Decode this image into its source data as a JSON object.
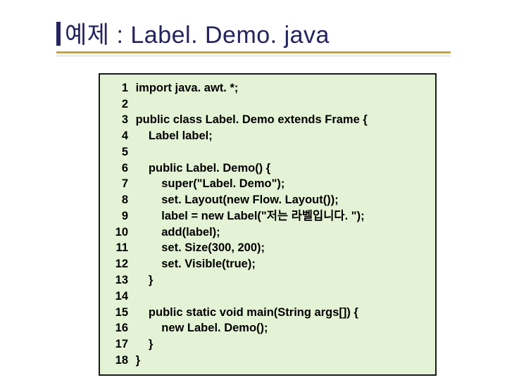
{
  "slide": {
    "title": "예제 : Label. Demo. java"
  },
  "code": {
    "lines": [
      {
        "n": "1",
        "t": " import java. awt. *;"
      },
      {
        "n": "2",
        "t": ""
      },
      {
        "n": "3",
        "t": " public class Label. Demo extends Frame {"
      },
      {
        "n": "4",
        "t": "     Label label;"
      },
      {
        "n": "5",
        "t": ""
      },
      {
        "n": "6",
        "t": "     public Label. Demo() {"
      },
      {
        "n": "7",
        "t": "         super(\"Label. Demo\");"
      },
      {
        "n": "8",
        "t": "         set. Layout(new Flow. Layout());"
      },
      {
        "n": "9",
        "t": "         label = new Label(\"저는 라벨입니다. \");"
      },
      {
        "n": "10",
        "t": "         add(label);"
      },
      {
        "n": "11",
        "t": "         set. Size(300, 200);"
      },
      {
        "n": "12",
        "t": "         set. Visible(true);"
      },
      {
        "n": "13",
        "t": "     }"
      },
      {
        "n": "14",
        "t": ""
      },
      {
        "n": "15",
        "t": "     public static void main(String args[]) {"
      },
      {
        "n": "16",
        "t": "         new Label. Demo();"
      },
      {
        "n": "17",
        "t": "     }"
      },
      {
        "n": "18",
        "t": " }"
      }
    ]
  }
}
